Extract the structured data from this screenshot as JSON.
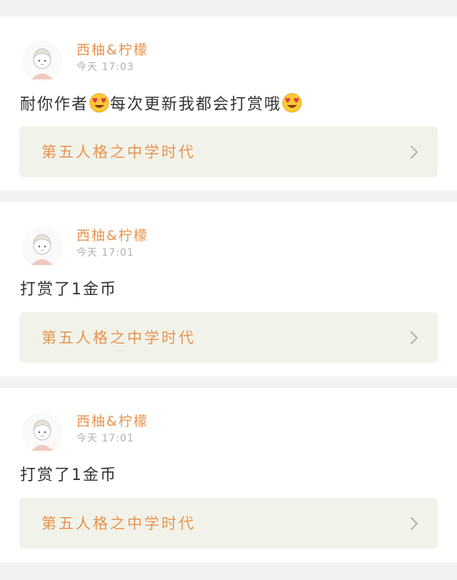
{
  "comments": [
    {
      "username": "西柚&柠檬",
      "timestamp": "今天 17:03",
      "message": {
        "part1": "耐你作者",
        "part2": "每次更新我都会打赏哦"
      },
      "work_title": "第五人格之中学时代"
    },
    {
      "username": "西柚&柠檬",
      "timestamp": "今天 17:01",
      "message": {
        "part1": "打赏了1金币",
        "part2": ""
      },
      "work_title": "第五人格之中学时代"
    },
    {
      "username": "西柚&柠檬",
      "timestamp": "今天 17:01",
      "message": {
        "part1": "打赏了1金币",
        "part2": ""
      },
      "work_title": "第五人格之中学时代"
    }
  ],
  "icons": {
    "emoji": "heart-eyes-emoji-icon",
    "chevron": "chevron-right-icon",
    "avatar": "anime-girl-avatar"
  },
  "colors": {
    "accent": "#e8934f",
    "link_background": "#f1f3ea",
    "timestamp": "#b0b0b0",
    "page_background": "#f2f2f2"
  }
}
